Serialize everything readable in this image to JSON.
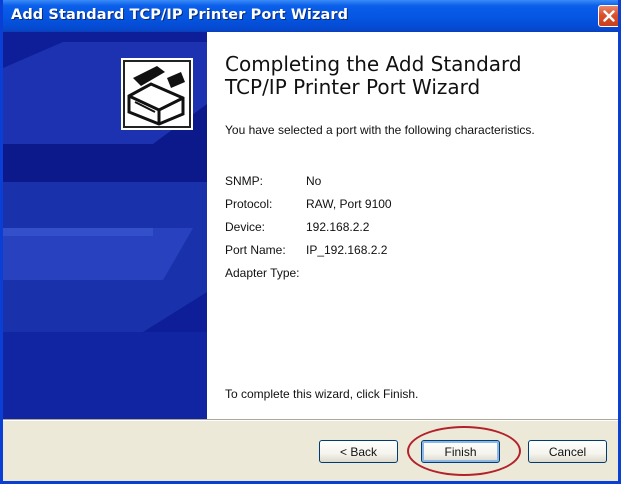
{
  "window": {
    "title": "Add Standard TCP/IP Printer Port Wizard"
  },
  "header": {
    "title_line1": "Completing the Add Standard",
    "title_line2": "TCP/IP Printer Port Wizard"
  },
  "intro": "You have selected a port with the following characteristics.",
  "characteristics": [
    {
      "label": "SNMP:",
      "value": "No"
    },
    {
      "label": "Protocol:",
      "value": "RAW, Port 9100"
    },
    {
      "label": "Device:",
      "value": "192.168.2.2"
    },
    {
      "label": "Port Name:",
      "value": "IP_192.168.2.2"
    },
    {
      "label": "Adapter Type:",
      "value": ""
    }
  ],
  "finish_note": "To complete this wizard, click Finish.",
  "buttons": {
    "back": "< Back",
    "finish": "Finish",
    "cancel": "Cancel"
  },
  "colors": {
    "titlebar": "#0556e2",
    "banner": "#0e1e99",
    "highlight_ring": "#b3212b"
  },
  "icons": [
    "printer-wizard-icon",
    "close-icon"
  ]
}
